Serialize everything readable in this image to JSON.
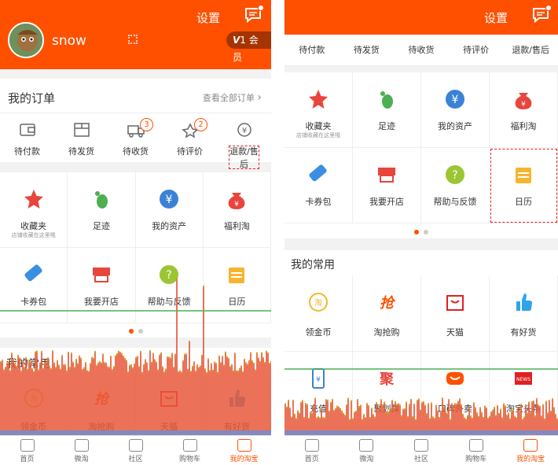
{
  "header": {
    "settings": "设置",
    "username": "snow",
    "vip_label": "会员"
  },
  "orders": {
    "title": "我的订单",
    "view_all": "查看全部订单",
    "items": [
      {
        "label": "待付款",
        "icon": "wallet-icon",
        "badge": ""
      },
      {
        "label": "待发货",
        "icon": "box-icon",
        "badge": ""
      },
      {
        "label": "待收货",
        "icon": "truck-icon",
        "badge": "3"
      },
      {
        "label": "待评价",
        "icon": "review-icon",
        "badge": "2"
      },
      {
        "label": "退款/售后",
        "icon": "refund-icon",
        "badge": ""
      }
    ]
  },
  "services": {
    "row1": [
      {
        "label": "收藏夹",
        "sub": "店铺收藏在这里哦",
        "icon": "star-icon",
        "color": "#e8453c"
      },
      {
        "label": "足迹",
        "sub": "",
        "icon": "footprint-icon",
        "color": "#4caf50"
      },
      {
        "label": "我的资产",
        "sub": "",
        "icon": "yen-icon",
        "color": "#3b82d6"
      },
      {
        "label": "福利淘",
        "sub": "",
        "icon": "money-bag-icon",
        "color": "#e8453c"
      }
    ],
    "row2": [
      {
        "label": "卡券包",
        "sub": "",
        "icon": "ticket-icon",
        "color": "#3b8fe0"
      },
      {
        "label": "我要开店",
        "sub": "",
        "icon": "shop-icon",
        "color": "#e8453c"
      },
      {
        "label": "帮助与反馈",
        "sub": "",
        "icon": "help-icon",
        "color": "#9cc534"
      },
      {
        "label": "日历",
        "sub": "",
        "icon": "calendar-icon",
        "color": "#f5b52e"
      }
    ]
  },
  "common": {
    "title": "我的常用",
    "row1": [
      {
        "label": "领金币",
        "icon": "coin-icon"
      },
      {
        "label": "淘抢购",
        "icon": "grab-icon"
      },
      {
        "label": "天猫",
        "icon": "tmall-icon"
      },
      {
        "label": "有好货",
        "icon": "thumb-icon"
      }
    ],
    "row2": [
      {
        "label": "充值",
        "icon": "phone-recharge-icon"
      },
      {
        "label": "聚划算",
        "icon": "juhuasuan-icon"
      },
      {
        "label": "口碑外卖",
        "icon": "koubei-icon"
      },
      {
        "label": "淘宝头条",
        "icon": "news-icon"
      }
    ]
  },
  "tabs": [
    {
      "label": "首页"
    },
    {
      "label": "微淘"
    },
    {
      "label": "社区"
    },
    {
      "label": "购物车"
    },
    {
      "label": "我的淘宝"
    }
  ],
  "colors": {
    "brand": "#ff5000",
    "overlay": "#e8593b",
    "line_green": "#4caf50",
    "line_blue": "#6a8fd8"
  }
}
